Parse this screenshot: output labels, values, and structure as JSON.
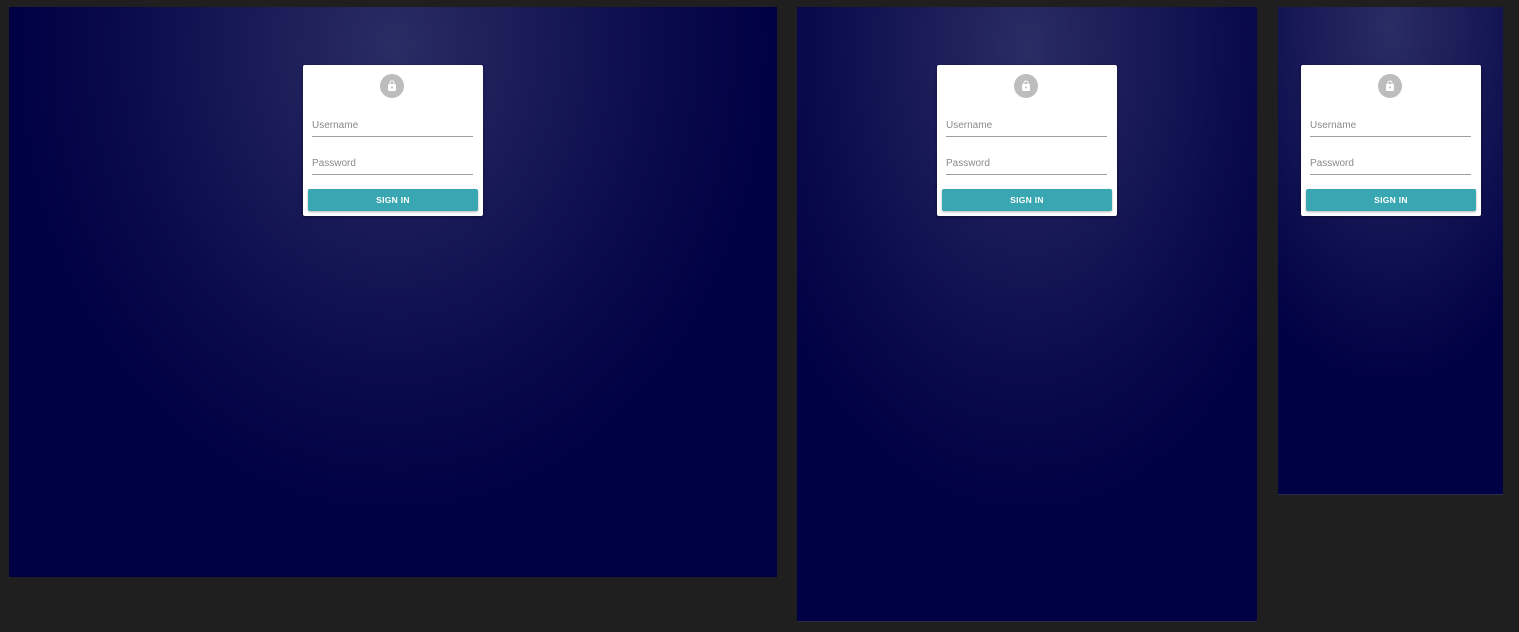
{
  "colors": {
    "outer_background": "#1f1f1f",
    "page_background": "#000044",
    "card_background": "#ffffff",
    "avatar_background": "#bdbdbd",
    "button_background": "#38a7b2",
    "button_text": "#ffffff"
  },
  "login_form": {
    "icon": "lock-icon",
    "username_placeholder": "Username",
    "password_placeholder": "Password",
    "signin_label": "SIGN IN"
  }
}
